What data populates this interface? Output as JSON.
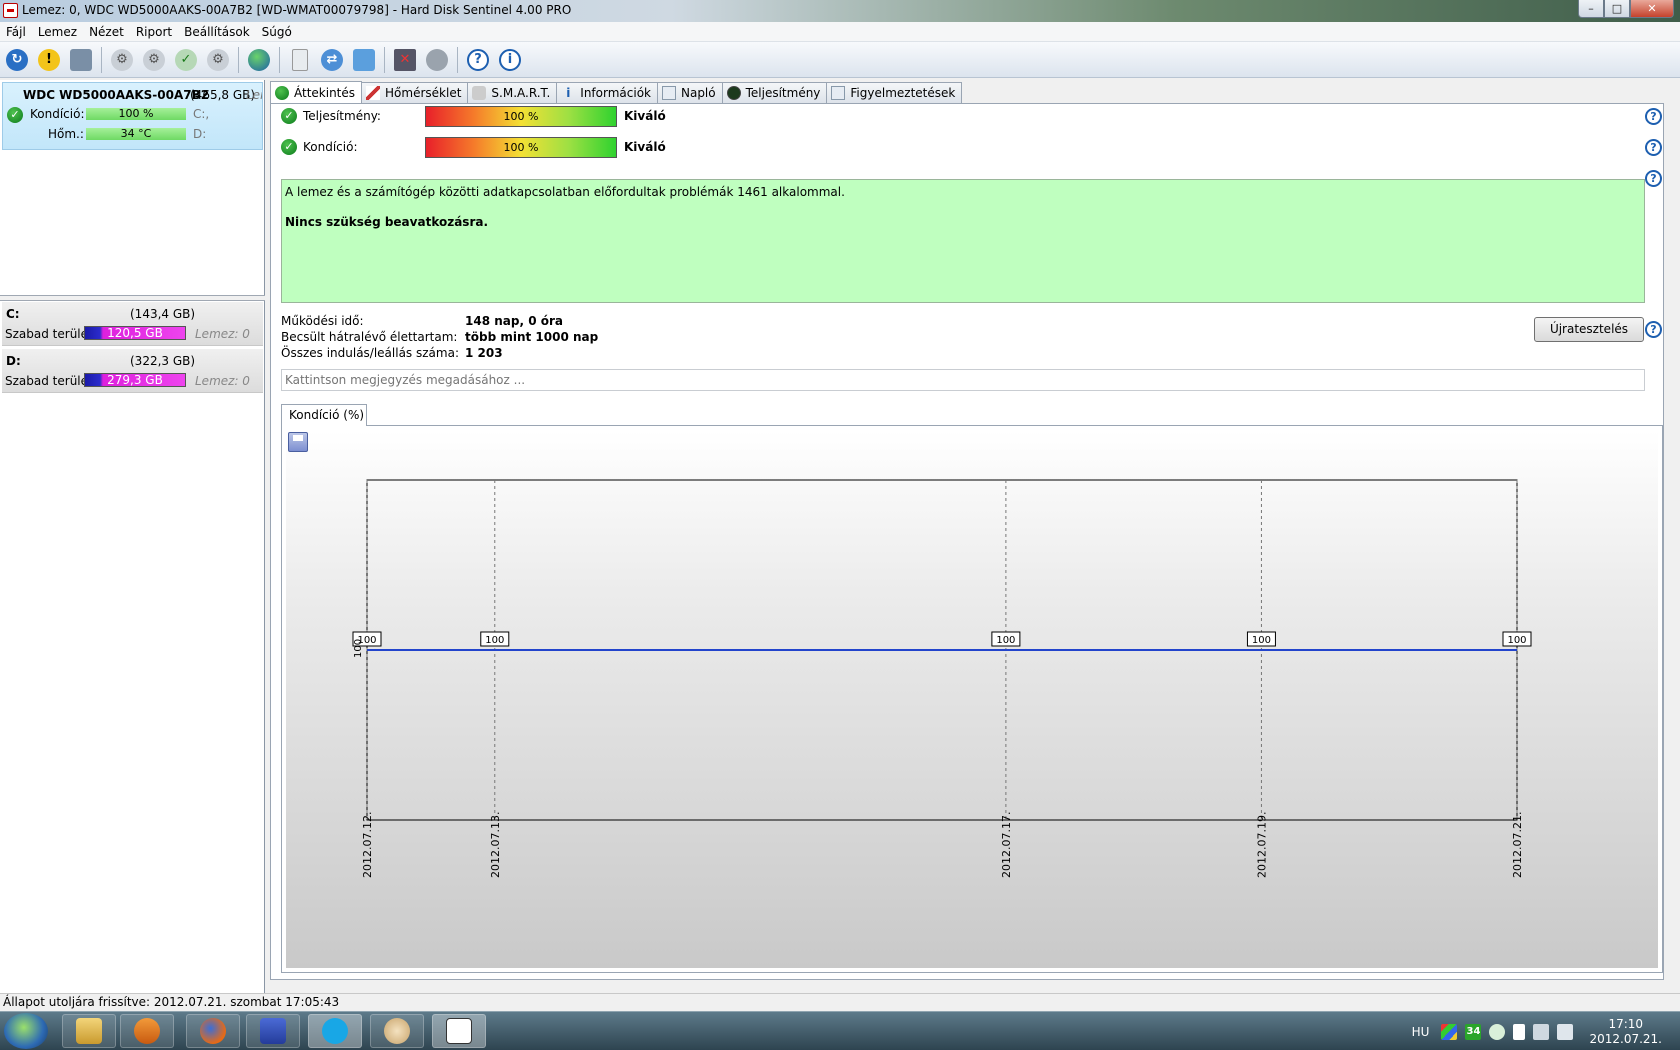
{
  "window": {
    "title": "Lemez: 0, WDC WD5000AAKS-00A7B2 [WD-WMAT00079798]  -  Hard Disk Sentinel 4.00 PRO",
    "controls": {
      "minimize": "–",
      "maximize": "□",
      "close": "✕"
    }
  },
  "menu": [
    "Fájl",
    "Lemez",
    "Nézet",
    "Riport",
    "Beállítások",
    "Súgó"
  ],
  "toolbar": {
    "icons": [
      "refresh-icon",
      "alert-icon",
      "disk-info-icon",
      "usb-disk-1-icon",
      "usb-disk-2-icon",
      "usb-disk-3-icon",
      "usb-disk-4-icon",
      "globe-icon",
      "report-icon",
      "sync-icon",
      "network-icon",
      "test-icon",
      "speaker-icon",
      "help-icon",
      "info-icon"
    ]
  },
  "left_panel": {
    "disk": {
      "name": "WDC WD5000AAKS-00A7B2",
      "size": "(465,8 GB)",
      "truncated": "Len",
      "health_label": "Kondíció:",
      "health_value": "100 %",
      "health_drive": "C:,",
      "temp_label": "Hőm.:",
      "temp_value": "34 °C",
      "temp_drive": "D:"
    },
    "volumes": [
      {
        "name": "C:",
        "size": "(143,4 GB)",
        "free_label": "Szabad terület",
        "free_value": "120,5 GB",
        "disk": "Lemez: 0"
      },
      {
        "name": "D:",
        "size": "(322,3 GB)",
        "free_label": "Szabad terület",
        "free_value": "279,3 GB",
        "disk": "Lemez: 0"
      }
    ]
  },
  "tabs": [
    "Áttekintés",
    "Hőmérséklet",
    "S.M.A.R.T.",
    "Információk",
    "Napló",
    "Teljesítmény",
    "Figyelmeztetések"
  ],
  "overview": {
    "performance_label": "Teljesítmény:",
    "performance_value": "100 %",
    "performance_rating": "Kiváló",
    "health_label": "Kondíció:",
    "health_value": "100 %",
    "health_rating": "Kiváló",
    "message_line1": "A lemez és a számítógép közötti adatkapcsolatban előfordultak problémák 1461 alkalommal.",
    "message_line2": "Nincs szükség beavatkozásra.",
    "uptime_label": "Működési idő:",
    "uptime_value": "148 nap, 0 óra",
    "lifetime_label": "Becsült hátralévő élettartam:",
    "lifetime_value": "több mint 1000 nap",
    "starts_label": "Összes indulás/leállás száma:",
    "starts_value": "1 203",
    "retest_button": "Újratesztelés",
    "note_placeholder": "Kattintson megjegyzés megadásához ...",
    "chart_tab": "Kondíció  (%)"
  },
  "chart_data": {
    "type": "line",
    "x": [
      "2012.07.12.",
      "2012.07.13.",
      "2012.07.17.",
      "2012.07.19.",
      "2012.07.21."
    ],
    "values": [
      100,
      100,
      100,
      100,
      100
    ],
    "ytick": "100",
    "grid": true,
    "color": "#2244cc"
  },
  "statusbar": {
    "text": "Állapot utoljára frissítve: 2012.07.21. szombat 17:05:43"
  },
  "taskbar": {
    "apps": [
      "explorer-icon",
      "media-player-icon",
      "firefox-icon",
      "save-disk-icon",
      "skype-icon",
      "paint-icon",
      "hd-sentinel-icon"
    ],
    "lang": "HU",
    "tray_temp": "34",
    "time": "17:10",
    "date": "2012.07.21."
  }
}
